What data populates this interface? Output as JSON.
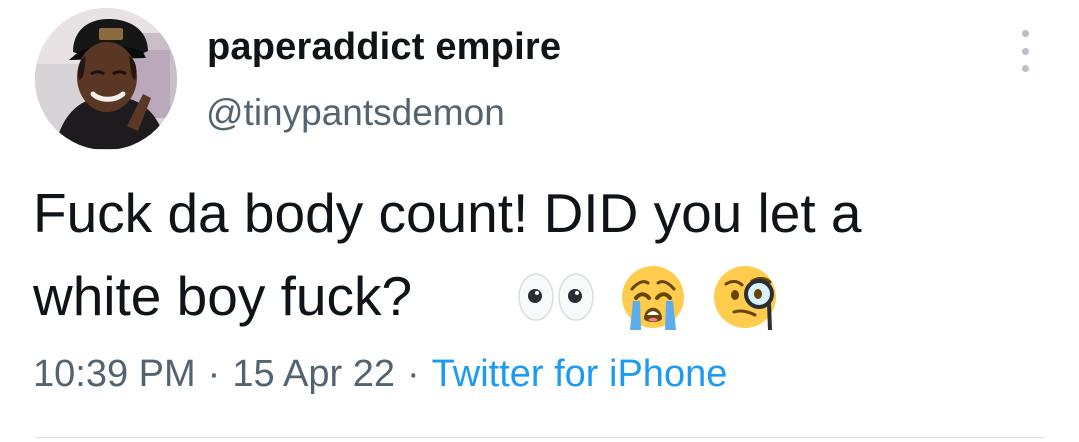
{
  "tweet": {
    "author": {
      "display_name": "paperaddict empire",
      "handle": "@tinypantsdemon"
    },
    "text_line_1": "Fuck da body count! DID you let a",
    "text_line_2": "white boy fuck?",
    "emoji_icons": [
      "eyes-icon",
      "crying-face-icon",
      "face-with-monocle-icon"
    ],
    "time": "10:39 PM",
    "date": "15 Apr 22",
    "separator": "·",
    "source": "Twitter for iPhone"
  },
  "colors": {
    "text": "#0f1419",
    "secondary": "#536471",
    "link": "#1d9bf0",
    "divider": "#dde3e8"
  }
}
